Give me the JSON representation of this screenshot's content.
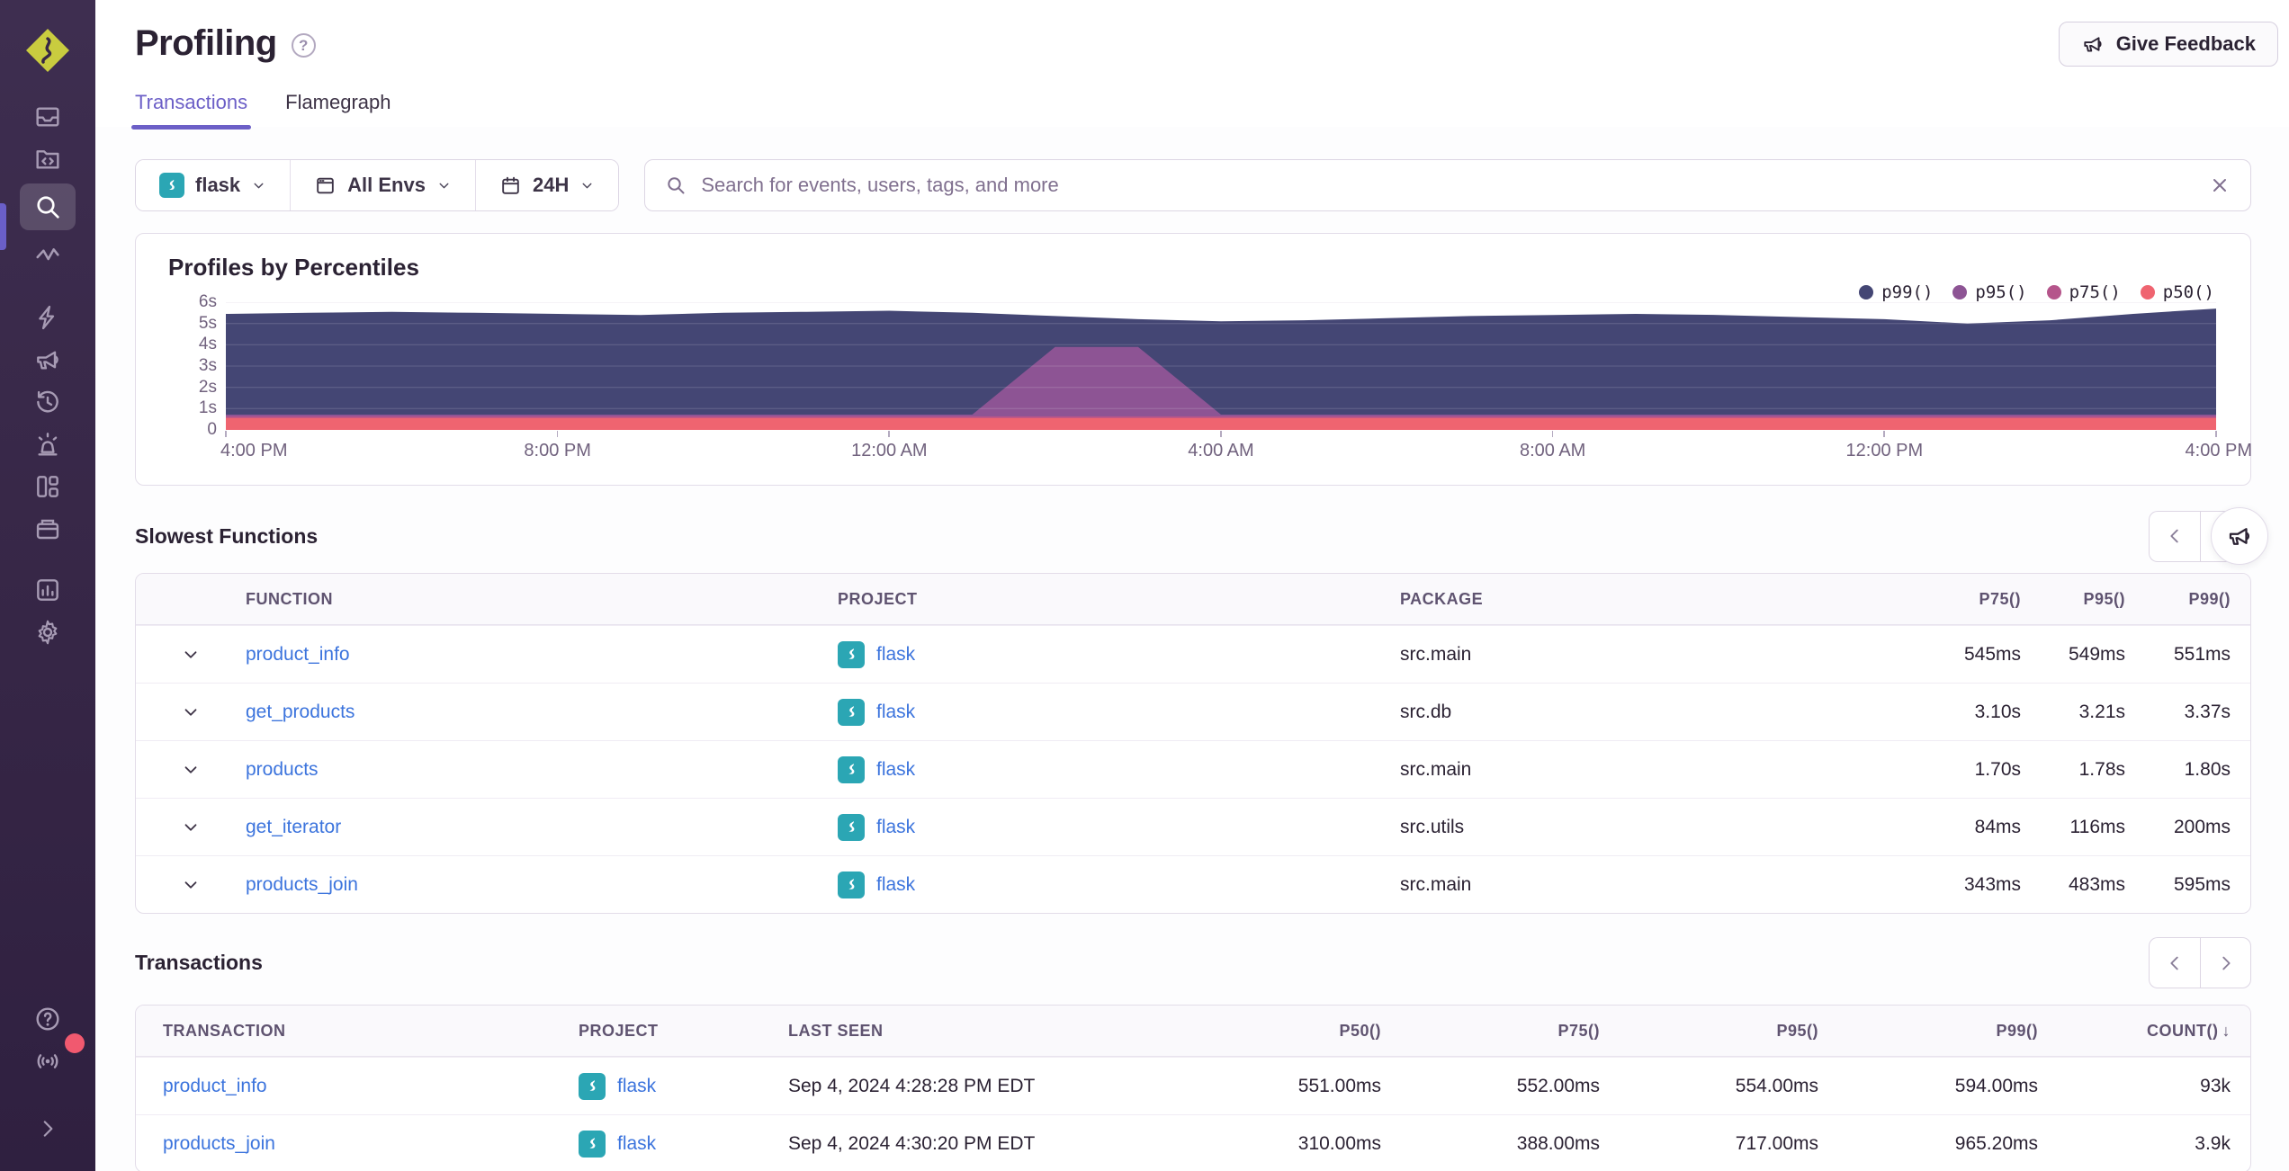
{
  "colors": {
    "accent_purple": "#6c5fc7",
    "sidebar_bg": "#362646",
    "link_blue": "#3c74dd",
    "project_teal": "#2ba6b4",
    "notification_red": "#f1596f"
  },
  "sidebar": {
    "items": [
      "sentry-logo",
      "issues-icon",
      "projects-icon",
      "explore-icon",
      "traces-icon",
      "performance-icon",
      "feedback-icon",
      "replays-icon",
      "alerts-icon",
      "dashboards-icon",
      "releases-icon",
      "stats-icon",
      "settings-icon",
      "help-icon",
      "whats-new-icon",
      "collapse-icon"
    ],
    "active_item": "explore-icon"
  },
  "header": {
    "title": "Profiling",
    "feedback_button": "Give Feedback"
  },
  "tabs": [
    {
      "label": "Transactions",
      "active": true
    },
    {
      "label": "Flamegraph",
      "active": false
    }
  ],
  "filters": {
    "project": "flask",
    "environment": "All Envs",
    "date_range": "24H"
  },
  "search": {
    "placeholder": "Search for events, users, tags, and more"
  },
  "chart_panel": {
    "title": "Profiles by Percentiles"
  },
  "chart_data": {
    "type": "area",
    "title": "Profiles by Percentiles",
    "ylim": [
      0,
      6
    ],
    "yticks": [
      "6s",
      "5s",
      "4s",
      "3s",
      "2s",
      "1s",
      "0"
    ],
    "x_labels": [
      "4:00 PM",
      "8:00 PM",
      "12:00 AM",
      "4:00 AM",
      "8:00 AM",
      "12:00 PM",
      "4:00 PM"
    ],
    "x_range_hours": 24,
    "grid": true,
    "legend_position": "top-right",
    "series": [
      {
        "name": "p99()",
        "color": "#444674",
        "values": [
          5.45,
          5.5,
          5.55,
          5.5,
          5.45,
          5.4,
          5.5,
          5.55,
          5.6,
          5.5,
          5.35,
          5.2,
          5.1,
          5.15,
          5.25,
          5.35,
          5.4,
          5.45,
          5.4,
          5.3,
          5.2,
          5.0,
          5.15,
          5.45,
          5.7
        ]
      },
      {
        "name": "p95()",
        "color": "#8d5494",
        "values": [
          0.72,
          0.72,
          0.72,
          0.72,
          0.72,
          0.72,
          0.72,
          0.72,
          0.72,
          0.72,
          3.9,
          3.9,
          0.72,
          0.72,
          0.72,
          0.72,
          0.72,
          0.72,
          0.72,
          0.72,
          0.72,
          0.72,
          0.72,
          0.72,
          0.72
        ]
      },
      {
        "name": "p75()",
        "color": "#b5558b",
        "values": [
          0.64,
          0.64,
          0.64,
          0.64,
          0.64,
          0.64,
          0.64,
          0.64,
          0.64,
          0.64,
          0.64,
          0.64,
          0.64,
          0.64,
          0.64,
          0.64,
          0.64,
          0.64,
          0.64,
          0.64,
          0.64,
          0.64,
          0.64,
          0.64,
          0.64
        ]
      },
      {
        "name": "p50()",
        "color": "#ef6470",
        "values": [
          0.56,
          0.56,
          0.56,
          0.56,
          0.56,
          0.56,
          0.56,
          0.56,
          0.56,
          0.56,
          0.56,
          0.56,
          0.56,
          0.56,
          0.56,
          0.56,
          0.56,
          0.56,
          0.56,
          0.56,
          0.56,
          0.56,
          0.56,
          0.56,
          0.56
        ]
      }
    ]
  },
  "slowest_functions": {
    "title": "Slowest Functions",
    "columns": [
      "FUNCTION",
      "PROJECT",
      "PACKAGE",
      "P75()",
      "P95()",
      "P99()"
    ],
    "rows": [
      {
        "function": "product_info",
        "project": "flask",
        "package": "src.main",
        "p75": "545ms",
        "p95": "549ms",
        "p99": "551ms"
      },
      {
        "function": "get_products",
        "project": "flask",
        "package": "src.db",
        "p75": "3.10s",
        "p95": "3.21s",
        "p99": "3.37s"
      },
      {
        "function": "products",
        "project": "flask",
        "package": "src.main",
        "p75": "1.70s",
        "p95": "1.78s",
        "p99": "1.80s"
      },
      {
        "function": "get_iterator",
        "project": "flask",
        "package": "src.utils",
        "p75": "84ms",
        "p95": "116ms",
        "p99": "200ms"
      },
      {
        "function": "products_join",
        "project": "flask",
        "package": "src.main",
        "p75": "343ms",
        "p95": "483ms",
        "p99": "595ms"
      }
    ]
  },
  "transactions": {
    "title": "Transactions",
    "columns": [
      "TRANSACTION",
      "PROJECT",
      "LAST SEEN",
      "P50()",
      "P75()",
      "P95()",
      "P99()",
      "COUNT()"
    ],
    "sort": {
      "column": "COUNT()",
      "direction": "desc",
      "icon": "↓"
    },
    "rows": [
      {
        "transaction": "product_info",
        "project": "flask",
        "last_seen": "Sep 4, 2024 4:28:28 PM EDT",
        "p50": "551.00ms",
        "p75": "552.00ms",
        "p95": "554.00ms",
        "p99": "594.00ms",
        "count": "93k"
      },
      {
        "transaction": "products_join",
        "project": "flask",
        "last_seen": "Sep 4, 2024 4:30:20 PM EDT",
        "p50": "310.00ms",
        "p75": "388.00ms",
        "p95": "717.00ms",
        "p99": "965.20ms",
        "count": "3.9k"
      }
    ]
  }
}
